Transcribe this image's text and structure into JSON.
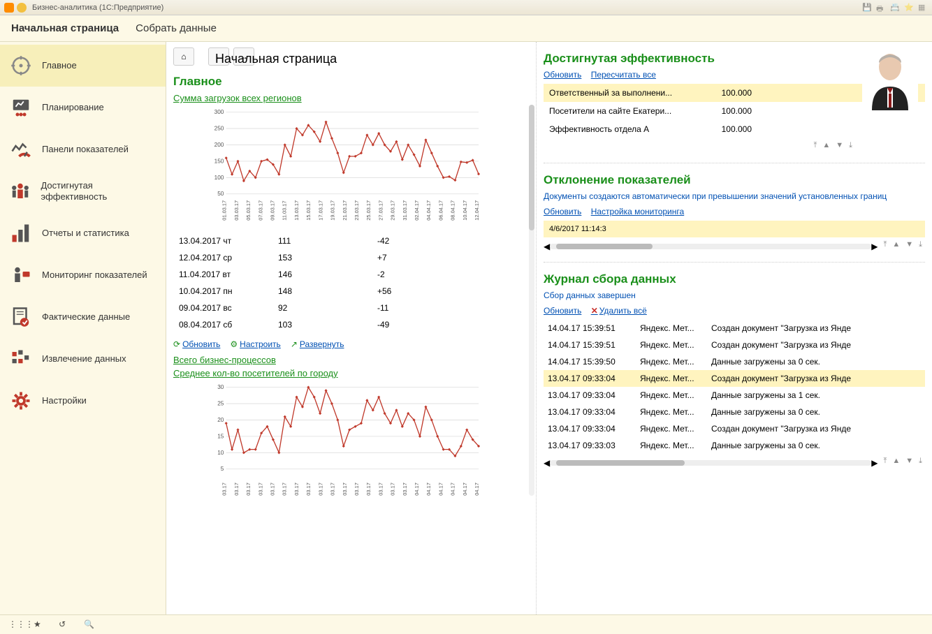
{
  "window": {
    "title": "Бизнес-аналитика  (1С:Предприятие)"
  },
  "topbar": {
    "tabs": [
      "Начальная страница",
      "Собрать данные"
    ]
  },
  "sidebar": {
    "items": [
      {
        "label": "Главное"
      },
      {
        "label": "Планирование"
      },
      {
        "label": "Панели показателей"
      },
      {
        "label": "Достигнутая эффективность"
      },
      {
        "label": "Отчеты и статистика"
      },
      {
        "label": "Мониторинг показателей"
      },
      {
        "label": "Фактические данные"
      },
      {
        "label": "Извлечение данных"
      },
      {
        "label": "Настройки"
      }
    ]
  },
  "page": {
    "title": "Начальная страница"
  },
  "main_block": {
    "heading": "Главное",
    "chart1_title": "Сумма загрузок всех регионов",
    "chart2_title": "Среднее кол-во посетителей по городу",
    "link_bp": "Всего бизнес-процессов",
    "tools": {
      "refresh": "Обновить",
      "configure": "Настроить",
      "expand": "Развернуть"
    },
    "table": [
      {
        "d": "13.04.2017 чт",
        "v": "111",
        "dv": "-42"
      },
      {
        "d": "12.04.2017 ср",
        "v": "153",
        "dv": "+7"
      },
      {
        "d": "11.04.2017 вт",
        "v": "146",
        "dv": "-2"
      },
      {
        "d": "10.04.2017 пн",
        "v": "148",
        "dv": "+56"
      },
      {
        "d": "09.04.2017 вс",
        "v": "92",
        "dv": "-11"
      },
      {
        "d": "08.04.2017 сб",
        "v": "103",
        "dv": "-49"
      }
    ]
  },
  "eff": {
    "heading": "Достигнутая эффективность",
    "links": {
      "refresh": "Обновить",
      "recalc": "Пересчитать все"
    },
    "rows": [
      {
        "n": "Ответственный за выполнени...",
        "v": "100.000"
      },
      {
        "n": "Посетители на сайте Екатери...",
        "v": "100.000"
      },
      {
        "n": "Эффективность отдела А",
        "v": "100.000"
      }
    ]
  },
  "dev": {
    "heading": "Отклонение показателей",
    "desc": "Документы создаются автоматически при превышении значений установленных границ",
    "links": {
      "refresh": "Обновить",
      "setup": "Настройка мониторинга"
    },
    "row_hint": "4/6/2017 11:14:3"
  },
  "log": {
    "heading": "Журнал сбора данных",
    "subtitle": "Сбор данных завершен",
    "links": {
      "refresh": "Обновить",
      "delete_all": "Удалить всё"
    },
    "rows": [
      {
        "t": "14.04.17 15:39:51",
        "s": "Яндекс. Мет...",
        "m": "Создан документ \"Загрузка из Янде"
      },
      {
        "t": "14.04.17 15:39:51",
        "s": "Яндекс. Мет...",
        "m": "Создан документ \"Загрузка из Янде"
      },
      {
        "t": "14.04.17 15:39:50",
        "s": "Яндекс. Мет...",
        "m": "Данные загружены за 0 сек."
      },
      {
        "t": "13.04.17 09:33:04",
        "s": "Яндекс. Мет...",
        "m": "Создан документ \"Загрузка из Янде"
      },
      {
        "t": "13.04.17 09:33:04",
        "s": "Яндекс. Мет...",
        "m": "Данные загружены за 1 сек."
      },
      {
        "t": "13.04.17 09:33:04",
        "s": "Яндекс. Мет...",
        "m": "Данные загружены за 0 сек."
      },
      {
        "t": "13.04.17 09:33:04",
        "s": "Яндекс. Мет...",
        "m": "Создан документ \"Загрузка из Янде"
      },
      {
        "t": "13.04.17 09:33:03",
        "s": "Яндекс. Мет...",
        "m": "Данные загружены за 0 сек."
      }
    ],
    "hl_index": 3
  },
  "chart_data": [
    {
      "type": "line",
      "title": "Сумма загрузок всех регионов",
      "categories": [
        "01.03.17",
        "03.03.17",
        "05.03.17",
        "07.03.17",
        "09.03.17",
        "11.03.17",
        "13.03.17",
        "15.03.17",
        "17.03.17",
        "19.03.17",
        "21.03.17",
        "23.03.17",
        "25.03.17",
        "27.03.17",
        "29.03.17",
        "31.03.17",
        "02.04.17",
        "04.04.17",
        "06.04.17",
        "08.04.17",
        "10.04.17",
        "12.04.17"
      ],
      "values": [
        160,
        110,
        150,
        90,
        120,
        100,
        150,
        155,
        140,
        110,
        200,
        165,
        250,
        230,
        260,
        240,
        210,
        270,
        220,
        175,
        115,
        165,
        165,
        175,
        230,
        200,
        235,
        200,
        180,
        210,
        155,
        200,
        170,
        135,
        215,
        175,
        135,
        100,
        103,
        92,
        148,
        146,
        153,
        111
      ],
      "ylim": [
        50,
        300
      ],
      "y_ticks": [
        50,
        100,
        150,
        200,
        250,
        300
      ]
    },
    {
      "type": "line",
      "title": "Среднее кол-во посетителей по городу",
      "categories": [
        "03.17",
        "03.17",
        "03.17",
        "03.17",
        "03.17",
        "03.17",
        "03.17",
        "03.17",
        "03.17",
        "03.17",
        "03.17",
        "03.17",
        "03.17",
        "03.17",
        "03.17",
        "03.17",
        "04.17",
        "04.17",
        "04.17",
        "04.17",
        "04.17",
        "04.17"
      ],
      "values": [
        19,
        11,
        17,
        10,
        11,
        11,
        16,
        18,
        14,
        10,
        21,
        18,
        27,
        24,
        30,
        27,
        22,
        29,
        25,
        20,
        12,
        17,
        18,
        19,
        26,
        23,
        27,
        22,
        19,
        23,
        18,
        22,
        20,
        15,
        24,
        20,
        15,
        11,
        11,
        9,
        12,
        17,
        14,
        12
      ],
      "ylim": [
        5,
        30
      ],
      "y_ticks": [
        5,
        10,
        15,
        20,
        25,
        30
      ]
    }
  ]
}
